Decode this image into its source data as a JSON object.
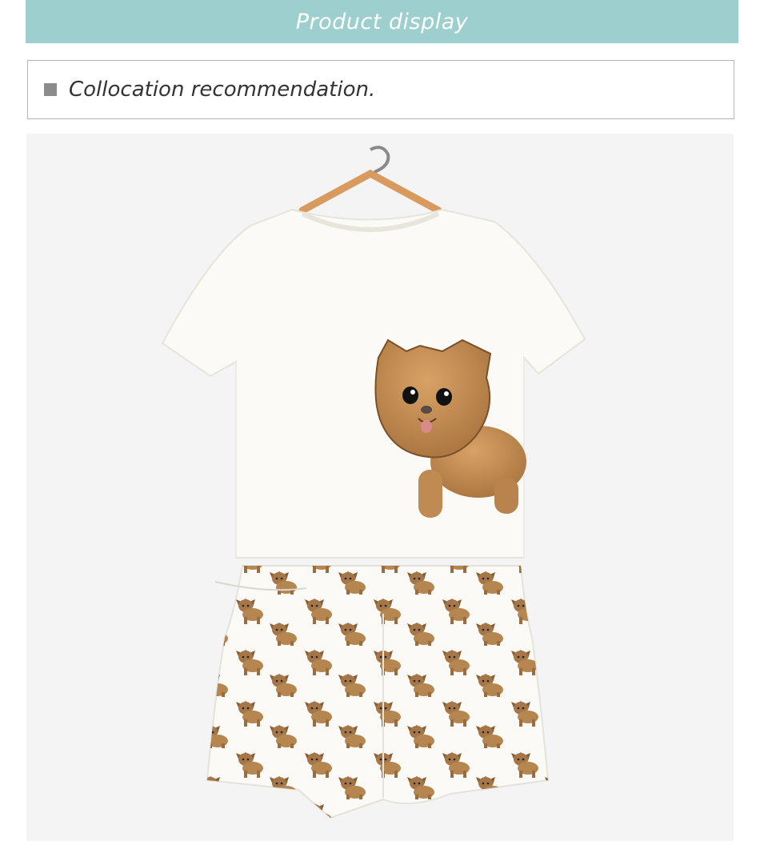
{
  "banner": {
    "title": "Product display",
    "background": "#9ccfcd"
  },
  "section": {
    "heading": "Collocation recommendation."
  },
  "photo": {
    "subject": "pajama-set-shirt-and-shorts",
    "icons": [
      "hanger-icon",
      "dog-print-icon",
      "dog-pattern-icon"
    ],
    "colors": {
      "shirt": "#fbfaf6",
      "dog": "#b88552",
      "hanger": "#d89a5e",
      "background": "#f4f4f4"
    }
  }
}
